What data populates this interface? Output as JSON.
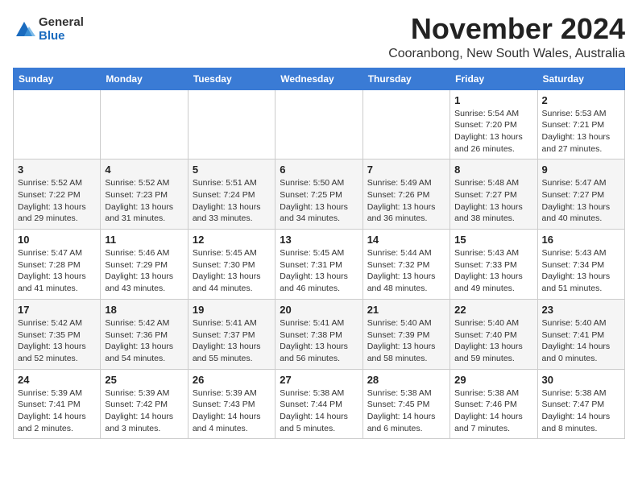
{
  "logo": {
    "general": "General",
    "blue": "Blue"
  },
  "title": "November 2024",
  "location": "Cooranbong, New South Wales, Australia",
  "weekdays": [
    "Sunday",
    "Monday",
    "Tuesday",
    "Wednesday",
    "Thursday",
    "Friday",
    "Saturday"
  ],
  "weeks": [
    [
      {
        "day": "",
        "info": ""
      },
      {
        "day": "",
        "info": ""
      },
      {
        "day": "",
        "info": ""
      },
      {
        "day": "",
        "info": ""
      },
      {
        "day": "",
        "info": ""
      },
      {
        "day": "1",
        "info": "Sunrise: 5:54 AM\nSunset: 7:20 PM\nDaylight: 13 hours and 26 minutes."
      },
      {
        "day": "2",
        "info": "Sunrise: 5:53 AM\nSunset: 7:21 PM\nDaylight: 13 hours and 27 minutes."
      }
    ],
    [
      {
        "day": "3",
        "info": "Sunrise: 5:52 AM\nSunset: 7:22 PM\nDaylight: 13 hours and 29 minutes."
      },
      {
        "day": "4",
        "info": "Sunrise: 5:52 AM\nSunset: 7:23 PM\nDaylight: 13 hours and 31 minutes."
      },
      {
        "day": "5",
        "info": "Sunrise: 5:51 AM\nSunset: 7:24 PM\nDaylight: 13 hours and 33 minutes."
      },
      {
        "day": "6",
        "info": "Sunrise: 5:50 AM\nSunset: 7:25 PM\nDaylight: 13 hours and 34 minutes."
      },
      {
        "day": "7",
        "info": "Sunrise: 5:49 AM\nSunset: 7:26 PM\nDaylight: 13 hours and 36 minutes."
      },
      {
        "day": "8",
        "info": "Sunrise: 5:48 AM\nSunset: 7:27 PM\nDaylight: 13 hours and 38 minutes."
      },
      {
        "day": "9",
        "info": "Sunrise: 5:47 AM\nSunset: 7:27 PM\nDaylight: 13 hours and 40 minutes."
      }
    ],
    [
      {
        "day": "10",
        "info": "Sunrise: 5:47 AM\nSunset: 7:28 PM\nDaylight: 13 hours and 41 minutes."
      },
      {
        "day": "11",
        "info": "Sunrise: 5:46 AM\nSunset: 7:29 PM\nDaylight: 13 hours and 43 minutes."
      },
      {
        "day": "12",
        "info": "Sunrise: 5:45 AM\nSunset: 7:30 PM\nDaylight: 13 hours and 44 minutes."
      },
      {
        "day": "13",
        "info": "Sunrise: 5:45 AM\nSunset: 7:31 PM\nDaylight: 13 hours and 46 minutes."
      },
      {
        "day": "14",
        "info": "Sunrise: 5:44 AM\nSunset: 7:32 PM\nDaylight: 13 hours and 48 minutes."
      },
      {
        "day": "15",
        "info": "Sunrise: 5:43 AM\nSunset: 7:33 PM\nDaylight: 13 hours and 49 minutes."
      },
      {
        "day": "16",
        "info": "Sunrise: 5:43 AM\nSunset: 7:34 PM\nDaylight: 13 hours and 51 minutes."
      }
    ],
    [
      {
        "day": "17",
        "info": "Sunrise: 5:42 AM\nSunset: 7:35 PM\nDaylight: 13 hours and 52 minutes."
      },
      {
        "day": "18",
        "info": "Sunrise: 5:42 AM\nSunset: 7:36 PM\nDaylight: 13 hours and 54 minutes."
      },
      {
        "day": "19",
        "info": "Sunrise: 5:41 AM\nSunset: 7:37 PM\nDaylight: 13 hours and 55 minutes."
      },
      {
        "day": "20",
        "info": "Sunrise: 5:41 AM\nSunset: 7:38 PM\nDaylight: 13 hours and 56 minutes."
      },
      {
        "day": "21",
        "info": "Sunrise: 5:40 AM\nSunset: 7:39 PM\nDaylight: 13 hours and 58 minutes."
      },
      {
        "day": "22",
        "info": "Sunrise: 5:40 AM\nSunset: 7:40 PM\nDaylight: 13 hours and 59 minutes."
      },
      {
        "day": "23",
        "info": "Sunrise: 5:40 AM\nSunset: 7:41 PM\nDaylight: 14 hours and 0 minutes."
      }
    ],
    [
      {
        "day": "24",
        "info": "Sunrise: 5:39 AM\nSunset: 7:41 PM\nDaylight: 14 hours and 2 minutes."
      },
      {
        "day": "25",
        "info": "Sunrise: 5:39 AM\nSunset: 7:42 PM\nDaylight: 14 hours and 3 minutes."
      },
      {
        "day": "26",
        "info": "Sunrise: 5:39 AM\nSunset: 7:43 PM\nDaylight: 14 hours and 4 minutes."
      },
      {
        "day": "27",
        "info": "Sunrise: 5:38 AM\nSunset: 7:44 PM\nDaylight: 14 hours and 5 minutes."
      },
      {
        "day": "28",
        "info": "Sunrise: 5:38 AM\nSunset: 7:45 PM\nDaylight: 14 hours and 6 minutes."
      },
      {
        "day": "29",
        "info": "Sunrise: 5:38 AM\nSunset: 7:46 PM\nDaylight: 14 hours and 7 minutes."
      },
      {
        "day": "30",
        "info": "Sunrise: 5:38 AM\nSunset: 7:47 PM\nDaylight: 14 hours and 8 minutes."
      }
    ]
  ]
}
